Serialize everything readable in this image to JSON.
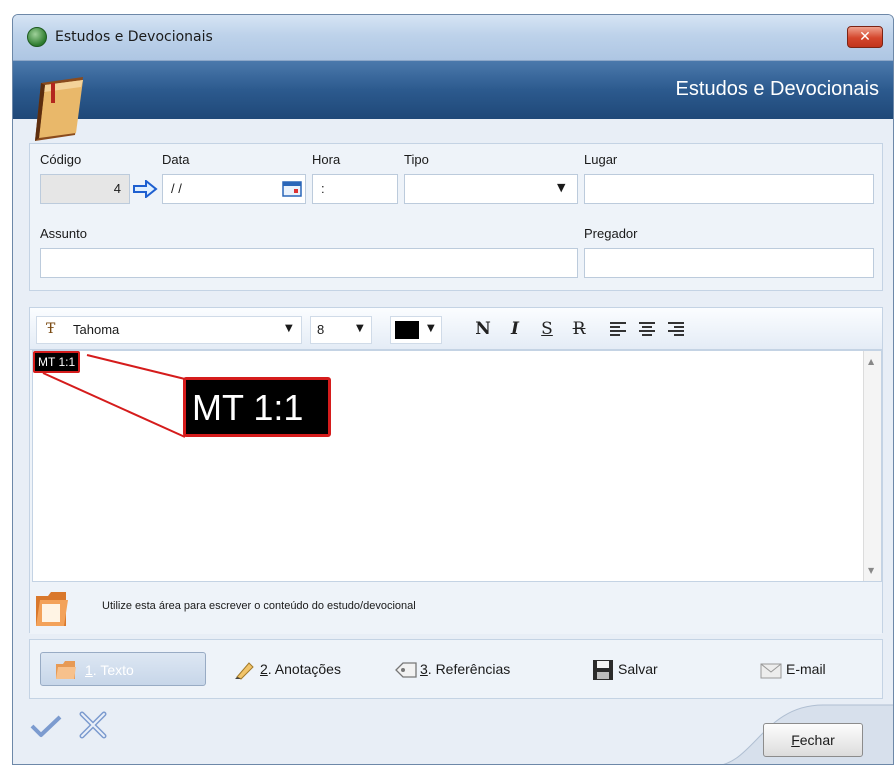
{
  "window": {
    "title": "Estudos e Devocionais",
    "close_label": "✕"
  },
  "banner": {
    "title": "Estudos e Devocionais"
  },
  "form": {
    "codigo": {
      "label": "Código",
      "value": "4"
    },
    "data": {
      "label": "Data",
      "value": "/ /"
    },
    "hora": {
      "label": "Hora",
      "value": ":"
    },
    "tipo": {
      "label": "Tipo",
      "value": ""
    },
    "lugar": {
      "label": "Lugar",
      "value": ""
    },
    "assunto": {
      "label": "Assunto",
      "value": ""
    },
    "pregador": {
      "label": "Pregador",
      "value": ""
    }
  },
  "toolbar": {
    "font": "Tahoma",
    "size": "8",
    "bold": "N",
    "italic": "I",
    "underline": "S",
    "strike": "R"
  },
  "editor": {
    "content": "MT 1:1",
    "zoom_content": "MT 1:1",
    "hint": "Utilize esta área para escrever o conteúdo do estudo/devocional"
  },
  "tabs": [
    {
      "prefix": "1",
      "label": ". Texto"
    },
    {
      "prefix": "2",
      "label": ". Anotações"
    },
    {
      "prefix": "3",
      "label": ". Referências"
    },
    {
      "prefix": "",
      "label": "Salvar"
    },
    {
      "prefix": "",
      "label": "E-mail"
    }
  ],
  "footer": {
    "close_prefix": "F",
    "close_label": "echar"
  },
  "colors": {
    "banner": "#2c5a8e",
    "highlight": "#d51c1c",
    "active_tab": "#c7d6e9"
  }
}
